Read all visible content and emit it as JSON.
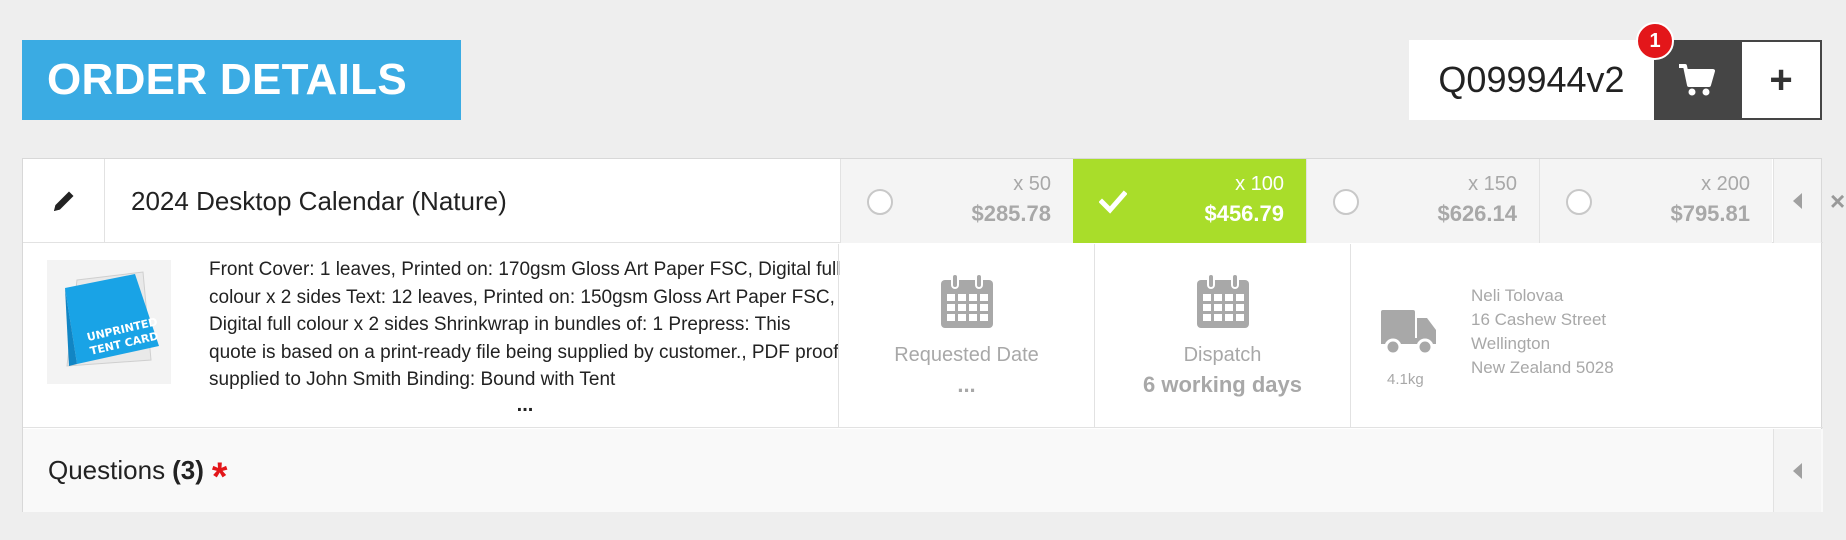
{
  "header": {
    "title": "ORDER DETAILS",
    "quote_number": "Q099944v2",
    "cart_badge": "1",
    "cart_icon": "shopping-cart-icon",
    "add_label": "+"
  },
  "product": {
    "name": "2024 Desktop Calendar (Nature)",
    "edit_icon": "pencil-icon",
    "thumbnail_text": [
      "UNPRINTED",
      "TENT CARD"
    ],
    "description": "Front Cover: 1 leaves, Printed on: 170gsm Gloss Art Paper FSC, Digital full colour x 2 sides Text: 12 leaves, Printed on: 150gsm Gloss Art Paper FSC, Digital full colour x 2 sides Shrinkwrap in bundles of: 1 Prepress: This quote is based on a print-ready file being supplied by customer., PDF proof supplied to John Smith Binding: Bound with Tent",
    "description_more": "..."
  },
  "quantities": [
    {
      "qty": "x 50",
      "price": "$285.78",
      "selected": false
    },
    {
      "qty": "x 100",
      "price": "$456.79",
      "selected": true
    },
    {
      "qty": "x 150",
      "price": "$626.14",
      "selected": false
    },
    {
      "qty": "x 200",
      "price": "$795.81",
      "selected": false
    }
  ],
  "requested_date": {
    "label": "Requested Date",
    "value": "..."
  },
  "dispatch": {
    "label": "Dispatch",
    "value": "6 working days"
  },
  "shipping": {
    "weight": "4.1kg",
    "address": [
      "Neli Tolovaa",
      "16 Cashew Street",
      "Wellington",
      "New Zealand 5028"
    ]
  },
  "questions": {
    "label": "Questions",
    "count": "(3)",
    "required_mark": "*"
  },
  "close_label": "×",
  "colors": {
    "accent_blue": "#3aabe3",
    "selected_green": "#a9dd2a",
    "badge_red": "#e3161a",
    "dark": "#454545"
  }
}
